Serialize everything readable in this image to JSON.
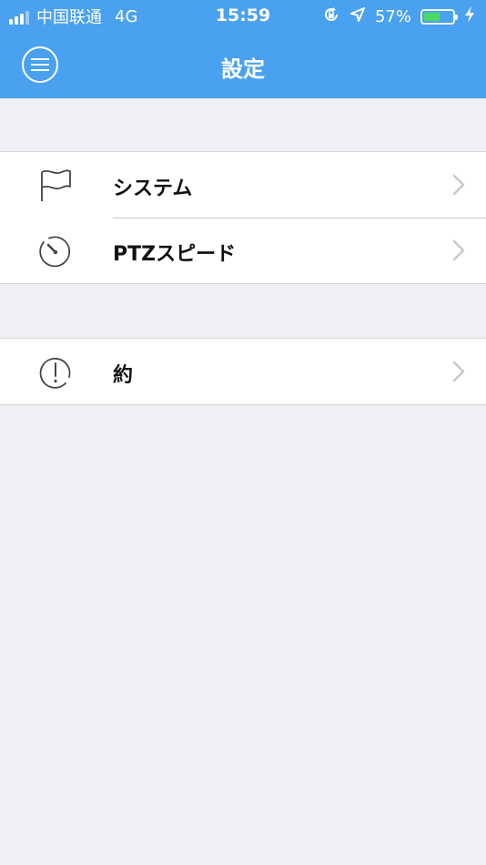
{
  "status_bar": {
    "carrier": "中国联通",
    "network": "4G",
    "time": "15:59",
    "battery_percent_text": "57%",
    "battery_level": 0.57,
    "icons": [
      "signal-icon",
      "rotation-lock-icon",
      "location-arrow-icon",
      "battery-icon",
      "charging-bolt-icon"
    ]
  },
  "nav": {
    "title": "設定",
    "menu_icon": "hamburger-menu-icon"
  },
  "settings": {
    "groups": [
      {
        "items": [
          {
            "label": "システム",
            "icon": "flag-icon"
          },
          {
            "label": "PTZスピード",
            "icon": "timer-icon"
          }
        ]
      },
      {
        "items": [
          {
            "label": "約",
            "icon": "info-exclamation-icon"
          }
        ]
      }
    ]
  },
  "colors": {
    "nav_background": "#4aa1ef",
    "page_background": "#efeff4",
    "battery_fill": "#4cd964",
    "chevron": "#c7c7cc",
    "icon_stroke": "#444444"
  }
}
